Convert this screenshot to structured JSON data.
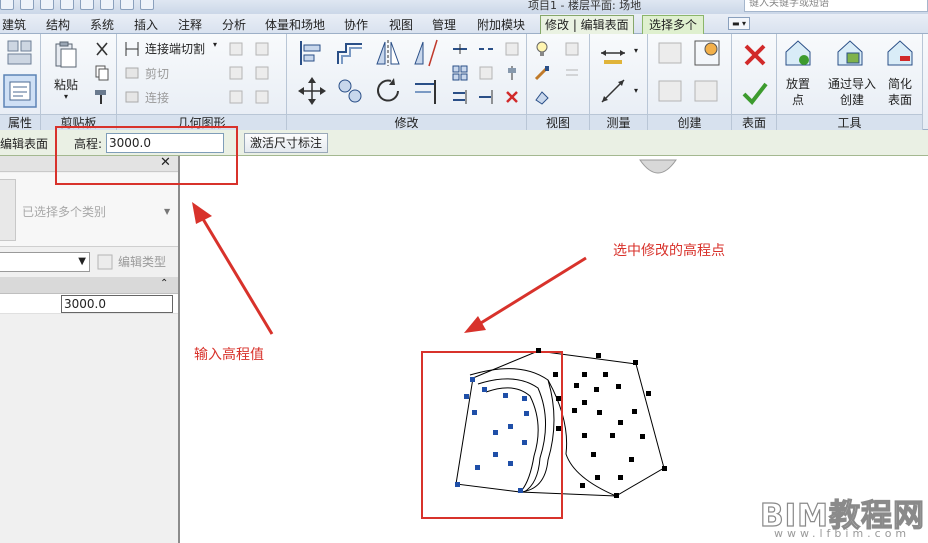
{
  "titlebar": {
    "document_title": "项目1 - 楼层平面: 场地",
    "search_placeholder": "键入关键字或短语"
  },
  "tabs": [
    {
      "label": "建筑"
    },
    {
      "label": "结构"
    },
    {
      "label": "系统"
    },
    {
      "label": "插入"
    },
    {
      "label": "注释"
    },
    {
      "label": "分析"
    },
    {
      "label": "体量和场地"
    },
    {
      "label": "协作"
    },
    {
      "label": "视图"
    },
    {
      "label": "管理"
    },
    {
      "label": "附加模块"
    },
    {
      "label": "修改 | 编辑表面"
    },
    {
      "label": "选择多个"
    }
  ],
  "ribbon": {
    "panels": {
      "properties": "属性",
      "clipboard": "剪贴板",
      "geometry": "几何图形",
      "modify": "修改",
      "view": "视图",
      "measure": "测量",
      "create": "创建",
      "surface": "表面",
      "tools": "工具"
    },
    "clipboard": {
      "paste": "粘贴"
    },
    "geometry": {
      "join_cut": "连接端切割",
      "cut": "剪切",
      "join": "连接"
    },
    "tools": {
      "place_point": "放置点",
      "create_from_import": "通过导入创建",
      "simplify_surface": "简化表面"
    }
  },
  "options_bar": {
    "title": "编辑表面",
    "elevation_label": "高程:",
    "elevation_value": "3000.0",
    "activate_dimensions": "激活尺寸标注"
  },
  "properties": {
    "type_selector": "已选择多个类别",
    "edit_type": "编辑类型",
    "param_value": "3000.0"
  },
  "annotations": {
    "select_points": "选中修改的高程点",
    "enter_elevation": "输入高程值"
  },
  "watermark": {
    "brand": "BIM教程网",
    "url": "www.lfbim.com"
  },
  "colors": {
    "annotation_red": "#d8322b",
    "selected_point": "#1f4fa8",
    "point": "#000000"
  }
}
